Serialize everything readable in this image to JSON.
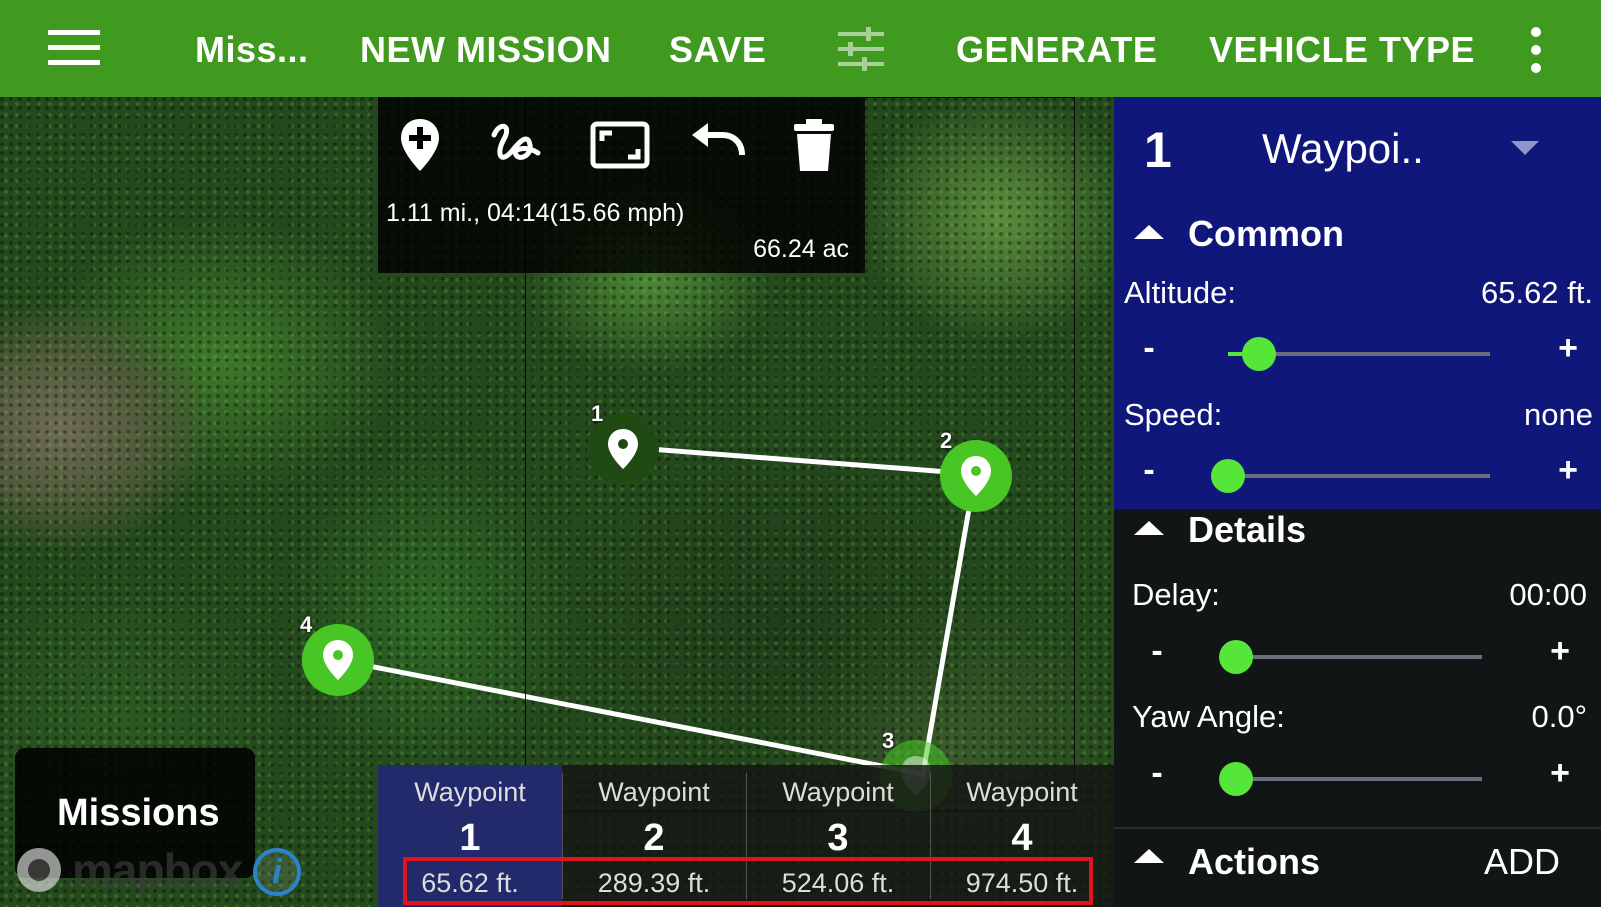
{
  "appbar": {
    "mission_name": "Miss...",
    "new_mission": "NEW MISSION",
    "save": "SAVE",
    "generate": "GENERATE",
    "vehicle_type": "VEHICLE TYPE",
    "color": "#3f9a1f"
  },
  "map_tools": {
    "icons": [
      "add-marker-icon",
      "freehand-draw-icon",
      "fit-bounds-icon",
      "undo-icon",
      "trash-icon"
    ],
    "distance_time": "1.11 mi., 04:14(15.66 mph)",
    "area": "66.24 ac"
  },
  "markers": [
    {
      "label": "1",
      "state": "selected"
    },
    {
      "label": "2",
      "state": "normal"
    },
    {
      "label": "3",
      "state": "faded"
    },
    {
      "label": "4",
      "state": "normal"
    }
  ],
  "waypoint_strip": {
    "items": [
      {
        "label": "Waypoint",
        "number": "1",
        "altitude": "65.62 ft.",
        "active": true
      },
      {
        "label": "Waypoint",
        "number": "2",
        "altitude": "289.39 ft.",
        "active": false
      },
      {
        "label": "Waypoint",
        "number": "3",
        "altitude": "524.06 ft.",
        "active": false
      },
      {
        "label": "Waypoint",
        "number": "4",
        "altitude": "974.50 ft.",
        "active": false
      }
    ]
  },
  "missions_button": "Missions",
  "mapbox": {
    "logo_text": "mapbox",
    "info": "i"
  },
  "panel": {
    "selected_number": "1",
    "selected_type": "Waypoi..",
    "common": {
      "title": "Common",
      "altitude_label": "Altitude:",
      "altitude_value": "65.62 ft.",
      "altitude_level": 0.12,
      "speed_label": "Speed:",
      "speed_value": "none",
      "speed_level": 0.0
    },
    "details": {
      "title": "Details",
      "delay_label": "Delay:",
      "delay_value": "00:00",
      "delay_level": 0.0,
      "yaw_label": "Yaw Angle:",
      "yaw_value": "0.0°",
      "yaw_level": 0.0
    },
    "actions": {
      "title": "Actions",
      "add": "ADD"
    },
    "minus": "-",
    "plus": "+",
    "accent": "#56e63a",
    "blue": "#10177a"
  }
}
